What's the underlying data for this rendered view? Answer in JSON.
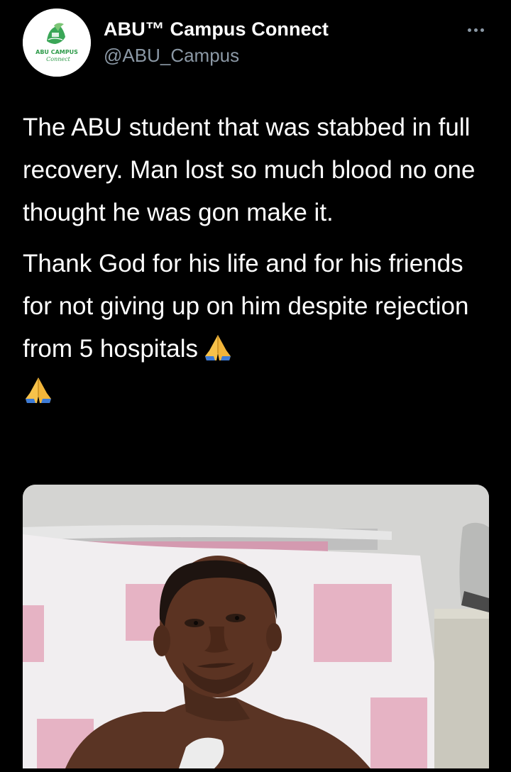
{
  "account": {
    "display_name": "ABU™ Campus Connect",
    "handle": "@ABU_Campus",
    "avatar_logo_text": "ABU CAMPUS",
    "avatar_logo_script": "Connect"
  },
  "tweet": {
    "paragraph_1": "The ABU student that was stabbed in full recovery. Man lost so much blood no one thought he was gon make it.",
    "paragraph_2": "Thank God for his life and for his friends for not giving up on him despite rejection from 5 hospitals",
    "emojis": [
      "folded-hands",
      "folded-hands"
    ]
  },
  "media": {
    "type": "photo"
  },
  "icons": {
    "more": "more-horizontal-icon",
    "pray": "folded-hands-emoji"
  },
  "colors": {
    "background": "#000000",
    "text": "#ffffff",
    "secondary_text": "#8b98a5",
    "logo_green": "#2e9b4a"
  }
}
